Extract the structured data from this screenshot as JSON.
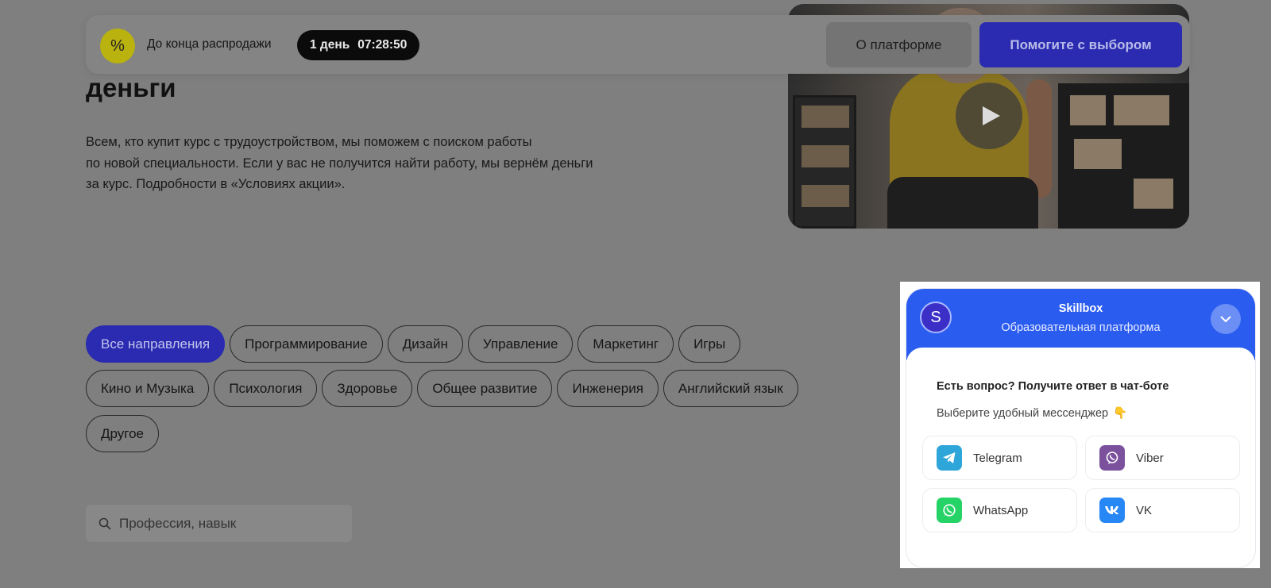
{
  "sale_bar": {
    "percent_symbol": "%",
    "text": "До конца распродажи",
    "timer_days": "1 день",
    "timer_time": "07:28:50",
    "about_button": "О платформе",
    "help_button": "Помогите с выбором"
  },
  "hero": {
    "headline_tail": "деньги",
    "description_lines": [
      "Всем, кто купит курс с трудоустройством, мы поможем с поиском работы",
      "по новой специальности. Если у вас не получится найти работу, мы вернём деньги",
      "за курс. Подробности в «Условиях акции»."
    ]
  },
  "categories": {
    "row1": [
      "Все направления",
      "Программирование",
      "Дизайн",
      "Управление",
      "Маркетинг",
      "Игры"
    ],
    "row2": [
      "Кино и Музыка",
      "Психология",
      "Здоровье",
      "Общее развитие",
      "Инженерия",
      "Английский язык"
    ],
    "row3": [
      "Другое"
    ],
    "active": "Все направления"
  },
  "search": {
    "placeholder": "Профессия, навык"
  },
  "chat": {
    "avatar_letter": "S",
    "title": "Skillbox",
    "subtitle": "Образовательная платформа",
    "question": "Есть вопрос? Получите ответ в чат-боте",
    "hint": "Выберите удобный мессенджер",
    "hint_emoji": "👇",
    "messengers": [
      {
        "label": "Telegram",
        "icon": "telegram-icon",
        "color": "#2ea6da"
      },
      {
        "label": "Viber",
        "icon": "viber-icon",
        "color": "#7b519d"
      },
      {
        "label": "WhatsApp",
        "icon": "whatsapp-icon",
        "color": "#25d366"
      },
      {
        "label": "VK",
        "icon": "vk-icon",
        "color": "#2787f5"
      }
    ]
  },
  "colors": {
    "accent": "#2a2bb0",
    "chat_header": "#2b5cf0",
    "overlay": "#7f7f7f"
  }
}
